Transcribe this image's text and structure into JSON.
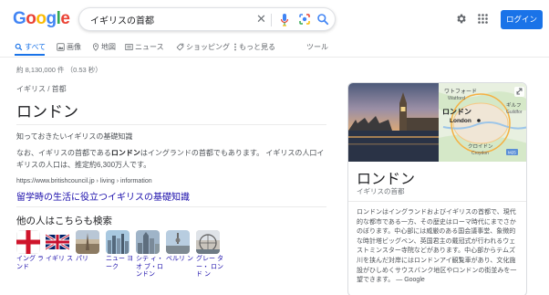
{
  "header": {
    "logo_letters": [
      {
        "ch": "G",
        "color": "#4285f4"
      },
      {
        "ch": "o",
        "color": "#ea4335"
      },
      {
        "ch": "o",
        "color": "#fbbc05"
      },
      {
        "ch": "g",
        "color": "#4285f4"
      },
      {
        "ch": "l",
        "color": "#34a853"
      },
      {
        "ch": "e",
        "color": "#ea4335"
      }
    ],
    "search_query": "イギリスの首都",
    "clear_glyph": "✕",
    "login_label": "ログイン"
  },
  "tabs": [
    {
      "label": "すべて",
      "icon": "search-icon",
      "active": true
    },
    {
      "label": "画像",
      "icon": "image-icon",
      "active": false
    },
    {
      "label": "地図",
      "icon": "map-pin-icon",
      "active": false
    },
    {
      "label": "ニュース",
      "icon": "news-icon",
      "active": false
    },
    {
      "label": "ショッピング",
      "icon": "tag-icon",
      "active": false
    },
    {
      "label": "もっと見る",
      "icon": "more-vert-icon",
      "active": false
    },
    {
      "label": "ツール",
      "icon": "",
      "active": false
    }
  ],
  "result_count": "約 8,130,000 件 （0.53 秒）",
  "answer": {
    "breadcrumb": "イギリス / 首都",
    "title": "ロンドン",
    "snippet_heading": "知っておきたいイギリスの基礎知識",
    "snippet_pre": "なお、イギリスの首都である",
    "snippet_bold": "ロンドン",
    "snippet_post": "はイングランドの首都でもあります。 イギリスの人口イギリスの人口は、推定約6,300万人です。",
    "source_url": "https://www.britishcouncil.jp › living › information",
    "source_title": "留学時の生活に役立つイギリスの基礎知識"
  },
  "related": {
    "heading": "他の人はこちらも検索",
    "items": [
      {
        "label": "イング ランド",
        "thumb": "flag-england"
      },
      {
        "label": "イギリ ス",
        "thumb": "flag-uk"
      },
      {
        "label": "パリ",
        "thumb": "paris"
      },
      {
        "label": "ニュー ヨーク",
        "thumb": "new-york"
      },
      {
        "label": "シテ ィ・オ ブ・ロ ンドン",
        "thumb": "city-of-london"
      },
      {
        "label": "ベルリ ン",
        "thumb": "berlin"
      },
      {
        "label": "グレー ター・ ロンド ン",
        "thumb": "greater-london"
      }
    ]
  },
  "knowledge_panel": {
    "title": "ロンドン",
    "subtitle": "イギリスの首都",
    "description": "ロンドンはイングランドおよびイギリスの首都で、現代的な都市である一方、その歴史はローマ時代にまでさかのぼります。中心部には威厳のある国会議事堂、象徴的な時計塔ビッグベン、英国君主の戴冠式が行われるウェストミンスター寺院などがあります。中心部からテムズ川を挟んだ対岸にはロンドンアイ観覧車があり、文化施設がひしめくサウスバンク地区やロンドンの街並みを一望できます。 — Google",
    "map_labels": {
      "watford_jp": "ワトフォード",
      "watford_en": "Watford",
      "city_jp": "ロンドン",
      "city_en": "London",
      "croydon_jp": "クロイドン",
      "croydon_en": "Croydon",
      "guildford_jp": "ギルフ",
      "guildford_en": "Guildfor",
      "road": "M25"
    }
  }
}
